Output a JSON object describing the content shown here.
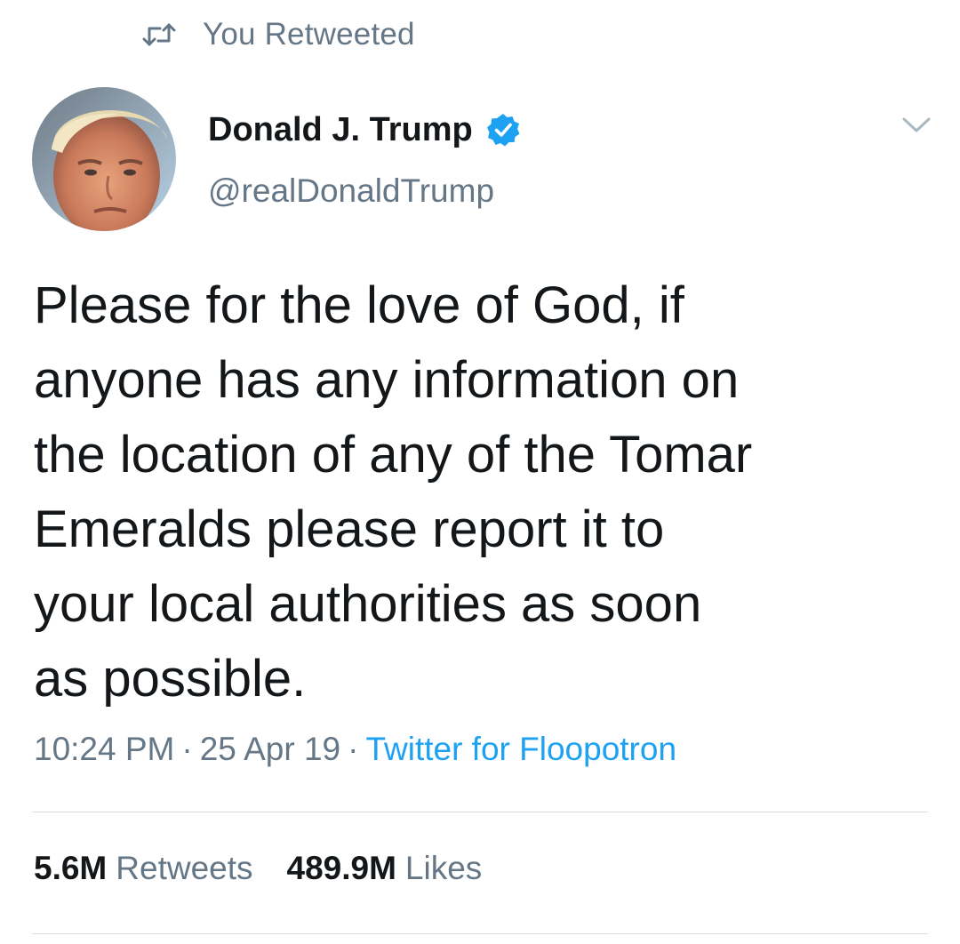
{
  "context": {
    "label": "You Retweeted"
  },
  "author": {
    "display_name": "Donald J. Trump",
    "handle": "@realDonaldTrump",
    "verified": true
  },
  "tweet": {
    "lines": [
      "Please for the love of God, if",
      "anyone has any information on",
      "the location of any of the Tomar",
      "Emeralds please report it to",
      "your local authorities as soon",
      "as possible."
    ],
    "time": "10:24 PM",
    "date": "25 Apr 19",
    "source": "Twitter for Floopotron",
    "separator": "·"
  },
  "stats": {
    "retweets_count": "5.6M",
    "retweets_label": "Retweets",
    "likes_count": "489.9M",
    "likes_label": "Likes"
  },
  "colors": {
    "text_primary": "#14171a",
    "text_secondary": "#657786",
    "accent": "#1da1f2",
    "divider": "#d8dde1"
  },
  "icons": {
    "retweet": "retweet-icon",
    "verified": "verified-badge-icon",
    "menu": "chevron-down-icon"
  }
}
